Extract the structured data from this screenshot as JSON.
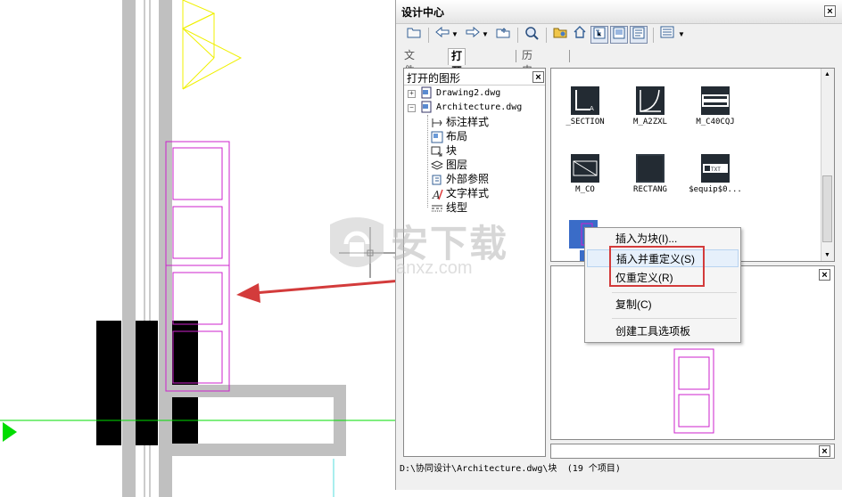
{
  "panel": {
    "title": "设计中心",
    "close": "×"
  },
  "toolbar": {
    "buttons": [
      "folder-open-icon",
      "back-icon",
      "dropdown-icon",
      "forward-icon",
      "dropdown-icon",
      "up-folder-icon",
      "search-icon",
      "favorites-icon",
      "home-icon",
      "tree-toggle-icon",
      "preview-icon",
      "description-icon",
      "views-icon",
      "dropdown-icon"
    ]
  },
  "tabs": {
    "folder": "文件夹",
    "open_drawings": "打开的图形",
    "history": "历史记录"
  },
  "tree": {
    "header": "打开的图形",
    "close": "×",
    "drawings": [
      {
        "label": "Drawing2.dwg",
        "expander": "+"
      },
      {
        "label": "Architecture.dwg",
        "expander": "−"
      }
    ],
    "children": [
      "标注样式",
      "布局",
      "块",
      "图层",
      "外部参照",
      "文字样式",
      "线型"
    ]
  },
  "blocks": [
    {
      "label": "_SECTION",
      "icon": "section-symbol-icon"
    },
    {
      "label": "M_A2ZXL",
      "icon": "arc-curve-icon"
    },
    {
      "label": "M_C40CQJ",
      "icon": "window-frame-icon"
    },
    {
      "label": "M_CO",
      "icon": "diagonal-box-icon"
    },
    {
      "label": "RECTANG",
      "icon": "rectangle-icon"
    },
    {
      "label": "$equip$0...",
      "icon": "equipment-icon"
    }
  ],
  "preview_close": "×",
  "description_close": "×",
  "status": {
    "path": "D:\\协同设计\\Architecture.dwg\\块",
    "count": "(19  个项目)"
  },
  "context_menu": {
    "items": [
      {
        "label": "插入为块(I)..."
      },
      {
        "label": "插入并重定义(S)"
      },
      {
        "label": "仅重定义(R)"
      },
      {
        "label": "复制(C)"
      },
      {
        "label": "创建工具选项板"
      }
    ]
  },
  "watermark": {
    "brand": "安下载",
    "domain": "anxz.com"
  },
  "colors": {
    "annotation_red": "#d33b3b",
    "magenta_lines": "#cc22cc",
    "cad_green": "#00dd00",
    "cad_yellow": "#ffff33",
    "cad_gray": "#c0c0c0"
  }
}
